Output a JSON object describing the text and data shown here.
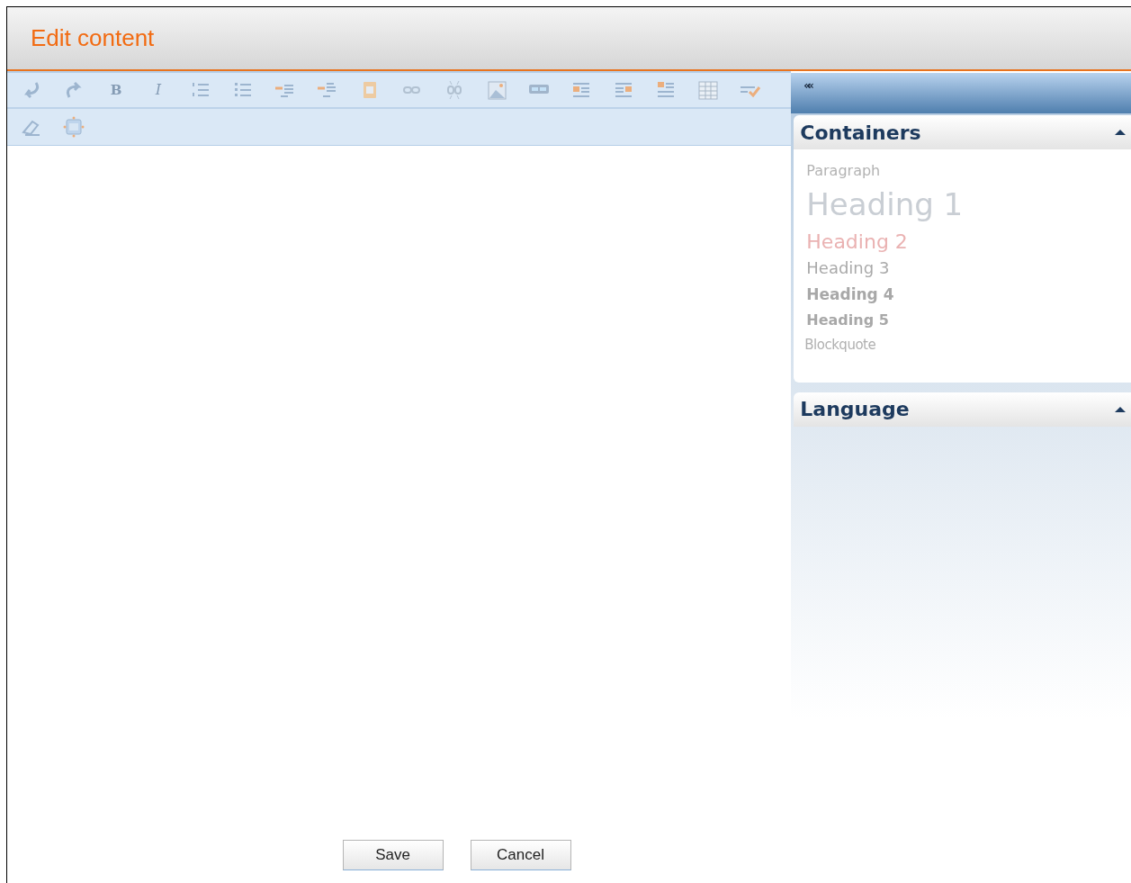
{
  "window": {
    "title": "Edit content"
  },
  "toolbar": {
    "disabled": true,
    "bold": "B",
    "italic": "I"
  },
  "sidebar": {
    "collapse": "««",
    "panels": [
      {
        "title": "Containers",
        "expanded": true,
        "items": [
          {
            "kind": "paragraph",
            "label": "Paragraph"
          },
          {
            "kind": "h1",
            "label": "Heading 1"
          },
          {
            "kind": "h2",
            "label": "Heading 2"
          },
          {
            "kind": "h3",
            "label": "Heading 3"
          },
          {
            "kind": "h4",
            "label": "Heading 4"
          },
          {
            "kind": "h5",
            "label": "Heading 5"
          },
          {
            "kind": "blockquote",
            "label": "Blockquote"
          }
        ]
      },
      {
        "title": "Language",
        "expanded": true
      }
    ]
  },
  "buttons": [
    "Save",
    "Cancel"
  ]
}
